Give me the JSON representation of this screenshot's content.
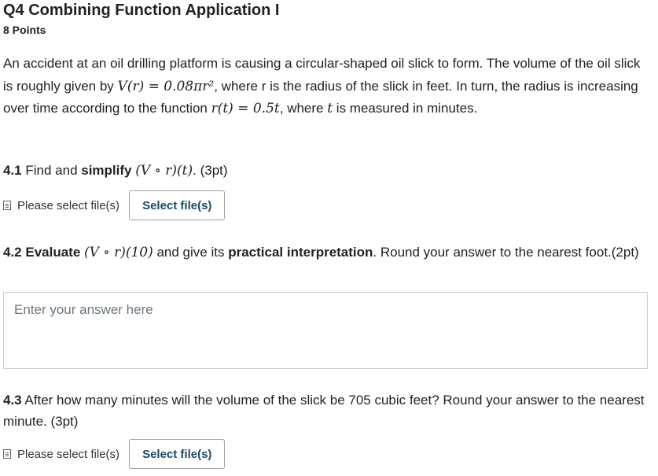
{
  "question": {
    "title": "Q4 Combining Function Application I",
    "points": "8 Points",
    "intro": {
      "t1": "An accident at an oil drilling platform is causing a circular-shaped oil slick to form. The volume of the oil slick is roughly given by ",
      "m1": "V(r) = 0.08πr²",
      "t2": ", where r is the radius of the slick in feet.  In turn, the radius is increasing over time according to the function ",
      "m2": "r(t) = 0.5t",
      "t3": ", where ",
      "m3": "t",
      "t4": " is measured in minutes."
    }
  },
  "part1": {
    "num": "4.1",
    "t1": " Find and ",
    "bold": "simplify",
    "m1": "(V ∘ r)(t)",
    "t2": ". (3pt)",
    "upload_label": "Please select file(s)",
    "button_label": "Select file(s)"
  },
  "part2": {
    "num": "4.2",
    "bold1": " Evaluate",
    "m1": "(V ∘ r)(10)",
    "t1": " and give its ",
    "bold2": "practical interpretation",
    "t2": ". Round your answer to the nearest foot.(2pt)",
    "answer_placeholder": "Enter your answer here"
  },
  "part3": {
    "num": "4.3",
    "text": " After how many minutes will the volume of the slick be 705 cubic feet? Round your answer to the nearest minute. (3pt)",
    "upload_label": "Please select file(s)",
    "button_label": "Select file(s)"
  }
}
